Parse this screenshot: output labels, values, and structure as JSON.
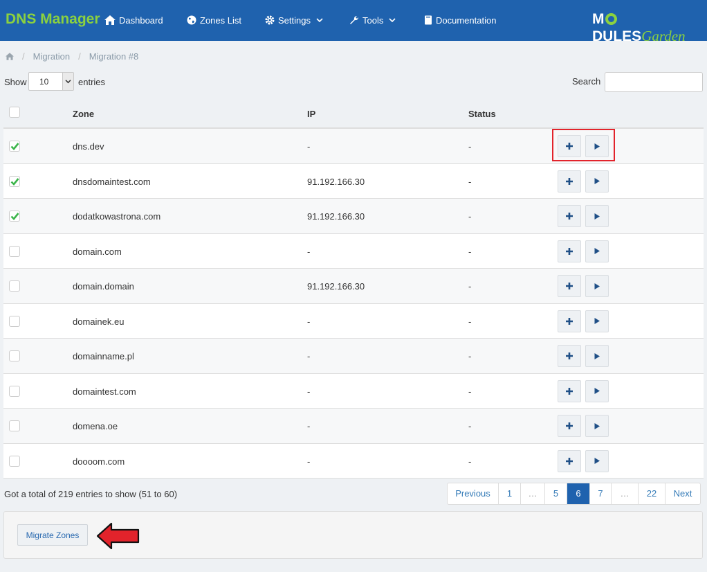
{
  "navbar": {
    "brand": "DNS Manager",
    "items": [
      {
        "label": "Dashboard",
        "icon": "home-icon"
      },
      {
        "label": "Zones List",
        "icon": "globe-icon"
      },
      {
        "label": "Settings",
        "icon": "gear-icon",
        "dropdown": true
      },
      {
        "label": "Tools",
        "icon": "wrench-icon",
        "dropdown": true
      },
      {
        "label": "Documentation",
        "icon": "book-icon"
      }
    ],
    "logo_part1": "M",
    "logo_part2": "DULES",
    "logo_part3": "Garden"
  },
  "breadcrumb": {
    "home_icon": "home-icon",
    "items": [
      "Migration",
      "Migration #8"
    ]
  },
  "table_controls": {
    "show_label": "Show",
    "length_value": "10",
    "entries_label": "entries",
    "search_label": "Search",
    "search_value": ""
  },
  "table": {
    "columns": [
      "Zone",
      "IP",
      "Status"
    ],
    "rows": [
      {
        "checked": true,
        "zone": "dns.dev",
        "ip": "-",
        "status": "-"
      },
      {
        "checked": true,
        "zone": "dnsdomaintest.com",
        "ip": "91.192.166.30",
        "status": "-"
      },
      {
        "checked": true,
        "zone": "dodatkowastrona.com",
        "ip": "91.192.166.30",
        "status": "-"
      },
      {
        "checked": false,
        "zone": "domain.com",
        "ip": "-",
        "status": "-"
      },
      {
        "checked": false,
        "zone": "domain.domain",
        "ip": "91.192.166.30",
        "status": "-"
      },
      {
        "checked": false,
        "zone": "domainek.eu",
        "ip": "-",
        "status": "-"
      },
      {
        "checked": false,
        "zone": "domainname.pl",
        "ip": "-",
        "status": "-"
      },
      {
        "checked": false,
        "zone": "domaintest.com",
        "ip": "-",
        "status": "-"
      },
      {
        "checked": false,
        "zone": "domena.oe",
        "ip": "-",
        "status": "-"
      },
      {
        "checked": false,
        "zone": "doooom.com",
        "ip": "-",
        "status": "-"
      }
    ]
  },
  "footer": {
    "info": "Got a total of 219 entries to show (51 to 60)",
    "pagination": [
      "Previous",
      "1",
      "…",
      "5",
      "6",
      "7",
      "…",
      "22",
      "Next"
    ],
    "active_page": "6",
    "migrate_button": "Migrate Zones"
  },
  "colors": {
    "navbar": "#1f62ae",
    "brand": "#8bd13f",
    "check": "#3bb54a",
    "highlight": "#e2232b",
    "arrow": "#e2232b"
  }
}
